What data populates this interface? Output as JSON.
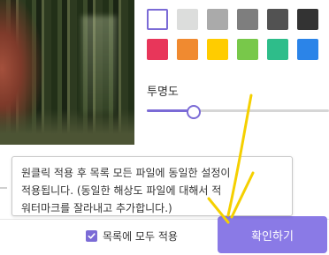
{
  "swatches": [
    {
      "color": "#ffffff",
      "selected": true
    },
    {
      "color": "#dcdddc",
      "selected": false
    },
    {
      "color": "#aaaaaa",
      "selected": false
    },
    {
      "color": "#7e7e7e",
      "selected": false
    },
    {
      "color": "#525252",
      "selected": false
    },
    {
      "color": "#333333",
      "selected": false
    },
    {
      "color": "#e8365a",
      "selected": false
    },
    {
      "color": "#f08a30",
      "selected": false
    },
    {
      "color": "#ffcc00",
      "selected": false
    },
    {
      "color": "#78c84a",
      "selected": false
    },
    {
      "color": "#2ebd8a",
      "selected": false
    },
    {
      "color": "#2b84e8",
      "selected": false
    }
  ],
  "opacity": {
    "label": "투명도",
    "value": 0.25
  },
  "tooltip": {
    "lines": [
      "원클릭 적용 후 목록 모든 파일에 동일한 설정이",
      "적용됩니다. (동일한 해상도 파일에 대해서 적",
      "워터마크를 잘라내고 추가합니다.)"
    ]
  },
  "footer": {
    "apply_all_label": "목록에 모두 적용",
    "apply_all_checked": true,
    "confirm_label": "확인하기"
  },
  "colors": {
    "accent": "#7b6bd6",
    "button": "#8a7ae6",
    "annotation_arrow": "#f5d000"
  }
}
